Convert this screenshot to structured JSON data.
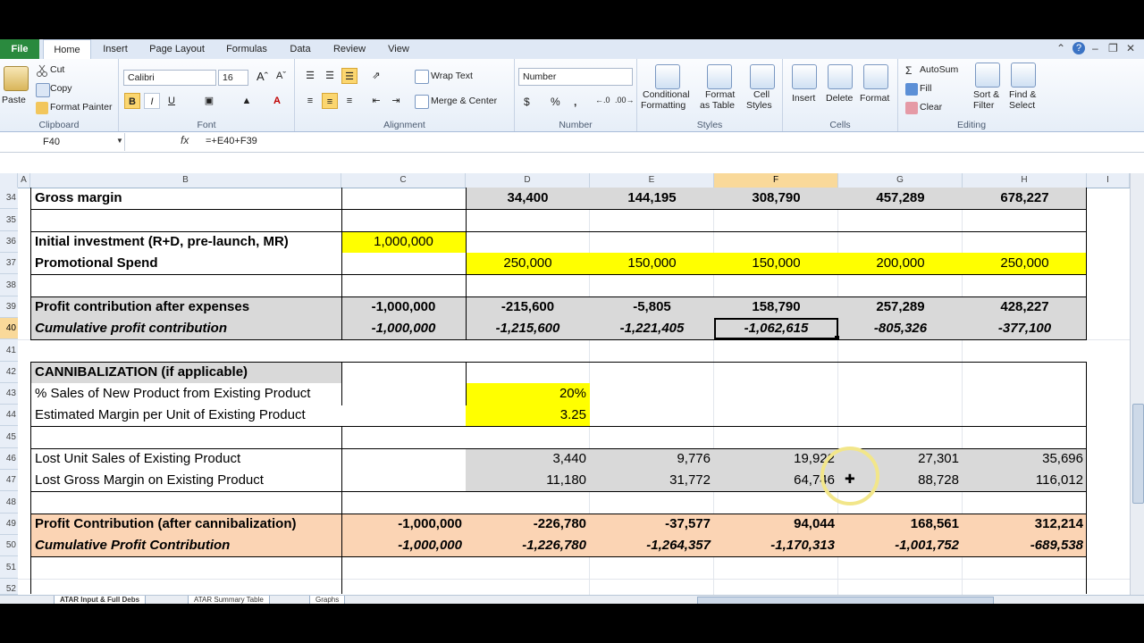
{
  "ribbon_tabs": [
    "File",
    "Home",
    "Insert",
    "Page Layout",
    "Formulas",
    "Data",
    "Review",
    "View"
  ],
  "clipboard": {
    "paste": "Paste",
    "cut": "Cut",
    "copy": "Copy",
    "format_painter": "Format Painter",
    "label": "Clipboard"
  },
  "font": {
    "name": "Calibri",
    "size": "16",
    "label": "Font"
  },
  "alignment": {
    "wrap": "Wrap Text",
    "merge": "Merge & Center",
    "label": "Alignment"
  },
  "number": {
    "format": "Number",
    "label": "Number"
  },
  "styles": {
    "conditional": "Conditional",
    "formatting": "Formatting",
    "format_as": "Format",
    "as_table": "as Table",
    "cell": "Cell",
    "cell_styles": "Styles",
    "label": "Styles"
  },
  "cells": {
    "insert": "Insert",
    "delete": "Delete",
    "format": "Format",
    "label": "Cells"
  },
  "editing": {
    "autosum": "AutoSum",
    "fill": "Fill",
    "clear": "Clear",
    "sort": "Sort &",
    "filter": "Filter",
    "find": "Find &",
    "select": "Select",
    "label": "Editing"
  },
  "formula_bar": {
    "name_box": "F40",
    "fx": "fx",
    "formula": "=+E40+F39"
  },
  "columns": [
    "A",
    "B",
    "C",
    "D",
    "E",
    "F",
    "G",
    "H",
    "I"
  ],
  "rows": [
    "34",
    "35",
    "36",
    "37",
    "38",
    "39",
    "40",
    "41",
    "42",
    "43",
    "44",
    "45",
    "46",
    "47",
    "48",
    "49",
    "50",
    "51",
    "52"
  ],
  "cells_data": {
    "r34": {
      "label": "Gross margin",
      "D": "34,400",
      "E": "144,195",
      "F": "308,790",
      "G": "457,289",
      "H": "678,227"
    },
    "r36": {
      "label": "Initial investment (R+D, pre-launch, MR)",
      "C": "1,000,000"
    },
    "r37": {
      "label": "Promotional Spend",
      "D": "250,000",
      "E": "150,000",
      "F": "150,000",
      "G": "200,000",
      "H": "250,000"
    },
    "r39": {
      "label": "Profit contribution after expenses",
      "C": "-1,000,000",
      "D": "-215,600",
      "E": "-5,805",
      "F": "158,790",
      "G": "257,289",
      "H": "428,227"
    },
    "r40": {
      "label": "Cumulative profit contribution",
      "C": "-1,000,000",
      "D": "-1,215,600",
      "E": "-1,221,405",
      "F": "-1,062,615",
      "G": "-805,326",
      "H": "-377,100"
    },
    "r42": {
      "label": "CANNIBALIZATION (if applicable)"
    },
    "r43": {
      "label": "% Sales of New Product from Existing Product",
      "D": "20%"
    },
    "r44": {
      "label": "Estimated Margin per Unit of Existing Product",
      "D": "3.25"
    },
    "r46": {
      "label": "Lost Unit Sales of Existing Product",
      "D": "3,440",
      "E": "9,776",
      "F": "19,922",
      "G": "27,301",
      "H": "35,696"
    },
    "r47": {
      "label": "Lost Gross Margin on Existing Product",
      "D": "11,180",
      "E": "31,772",
      "F": "64,746",
      "G": "88,728",
      "H": "116,012"
    },
    "r49": {
      "label": "Profit Contribution (after cannibalization)",
      "C": "-1,000,000",
      "D": "-226,780",
      "E": "-37,577",
      "F": "94,044",
      "G": "168,561",
      "H": "312,214"
    },
    "r50": {
      "label": "Cumulative Profit Contribution",
      "C": "-1,000,000",
      "D": "-1,226,780",
      "E": "-1,264,357",
      "F": "-1,170,313",
      "G": "-1,001,752",
      "H": "-689,538"
    }
  },
  "sheet_tabs": [
    "ATAR Input & Full Debs",
    "ATAR Summary Table",
    "Graphs"
  ],
  "colors": {
    "yellow": "#ffff00",
    "gray": "#d9d9d9",
    "peach": "#fbd4b4",
    "selected_header": "#f9d99a",
    "file_tab": "#2a8a3e"
  }
}
